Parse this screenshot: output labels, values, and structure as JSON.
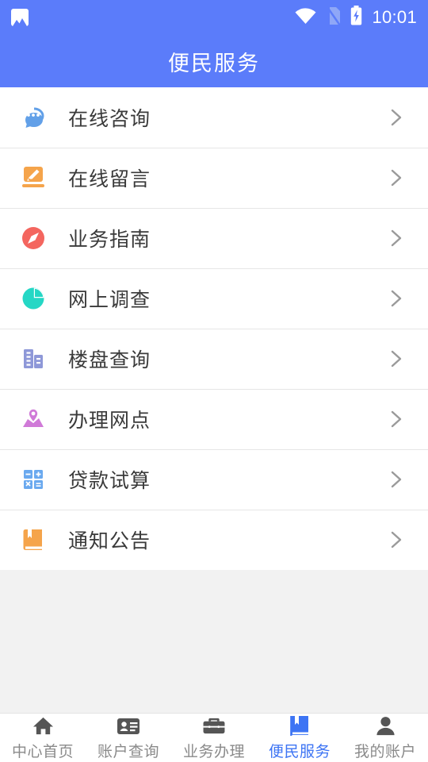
{
  "theme": {
    "header_bg": "#5b7cfa",
    "accent": "#3d74f4",
    "page_bg": "#f2f2f2",
    "list_bg": "#ffffff",
    "divider": "#e6e6e6",
    "label_color": "#3a3a3a",
    "tab_inactive": "#8a8a8a"
  },
  "statusbar": {
    "left_icon": "image-icon",
    "wifi_icon": "wifi-icon",
    "sim_icon": "no-sim-icon",
    "battery_icon": "battery-charging-icon",
    "time": "10:01"
  },
  "header": {
    "title": "便民服务"
  },
  "list": {
    "items": [
      {
        "label": "在线咨询",
        "icon": "chat-bubbles-icon",
        "color": "#62a0e8"
      },
      {
        "label": "在线留言",
        "icon": "edit-pencil-icon",
        "color": "#f5a44b"
      },
      {
        "label": "业务指南",
        "icon": "compass-icon",
        "color": "#f4665f"
      },
      {
        "label": "网上调查",
        "icon": "pie-chart-icon",
        "color": "#25d7c5"
      },
      {
        "label": "楼盘查询",
        "icon": "buildings-icon",
        "color": "#8e98d8"
      },
      {
        "label": "办理网点",
        "icon": "map-pin-icon",
        "color": "#d07ad8"
      },
      {
        "label": "贷款试算",
        "icon": "calculator-icon",
        "color": "#6aa9ef"
      },
      {
        "label": "通知公告",
        "icon": "book-icon",
        "color": "#f5a44b"
      }
    ],
    "chevron_icon": "chevron-right-icon"
  },
  "tabbar": {
    "items": [
      {
        "label": "中心首页",
        "icon": "home-icon",
        "active": false
      },
      {
        "label": "账户查询",
        "icon": "id-card-icon",
        "active": false
      },
      {
        "label": "业务办理",
        "icon": "briefcase-icon",
        "active": false
      },
      {
        "label": "便民服务",
        "icon": "book-icon",
        "active": true
      },
      {
        "label": "我的账户",
        "icon": "person-icon",
        "active": false
      }
    ]
  }
}
